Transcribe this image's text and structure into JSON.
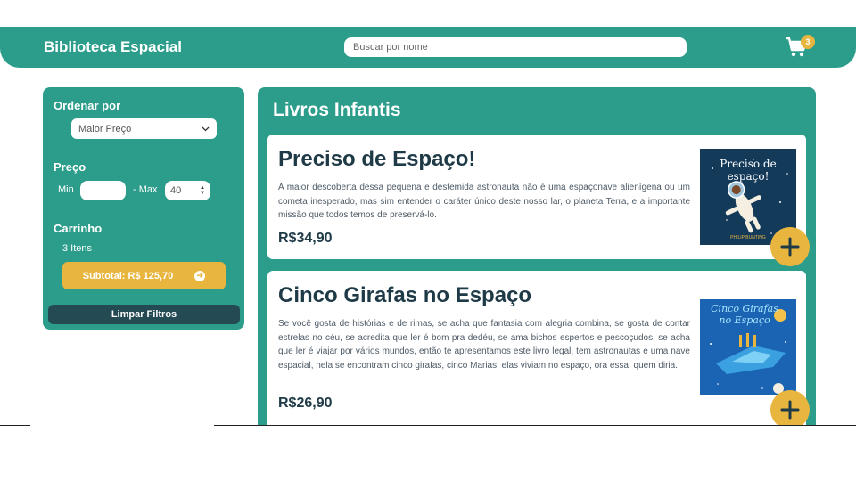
{
  "header": {
    "logo": "Biblioteca Espacial",
    "search_placeholder": "Buscar por nome",
    "cart_count": "3"
  },
  "sidebar": {
    "sort_heading": "Ordenar por",
    "sort_selected": "Maior Preço",
    "price_heading": "Preço",
    "min_label": "Min",
    "min_value": "",
    "max_label": "- Max",
    "max_value": "40",
    "cart_heading": "Carrinho",
    "items_count": "3 Itens",
    "subtotal_label": "Subtotal: R$ 125,70",
    "clear_label": "Limpar Filtros"
  },
  "main": {
    "title": "Livros Infantis",
    "books": [
      {
        "title": "Preciso de Espaço!",
        "description": "A maior descoberta dessa pequena e destemida astronauta não é uma espaçonave alienígena ou um cometa inesperado, mas sim entender o caráter único deste nosso lar, o planeta Terra, e a importante missão que todos temos de preservá-lo.",
        "price": "R$34,90",
        "cover_text": "Preciso de espaço!",
        "cover_author": "PHILIP BUNTING"
      },
      {
        "title": "Cinco Girafas no Espaço",
        "description": "Se você gosta de histórias e de rimas, se acha que fantasia com alegria combina, se gosta de contar estrelas no céu, se acredita que ler é bom pra dedéu, se ama bichos espertos e pescoçudos, se acha que ler é viajar por vários mundos, então te apresentamos este livro legal, tem astronautas e uma nave espacial, nela se encontram cinco girafas, cinco Marias, elas viviam no espaço, ora essa, quem diria.",
        "price": "R$26,90",
        "cover_text": "Cinco Girafas no Espaço"
      }
    ]
  },
  "colors": {
    "primary": "#2c9c8b",
    "accent": "#e8b53f",
    "dark": "#244a53",
    "text_dark": "#1f3a47"
  },
  "icons": {
    "cart": "shopping-cart-icon",
    "add": "plus-icon",
    "subtotal_arrow": "arrow-right-circle-icon",
    "select_arrow": "chevron-down-icon"
  }
}
